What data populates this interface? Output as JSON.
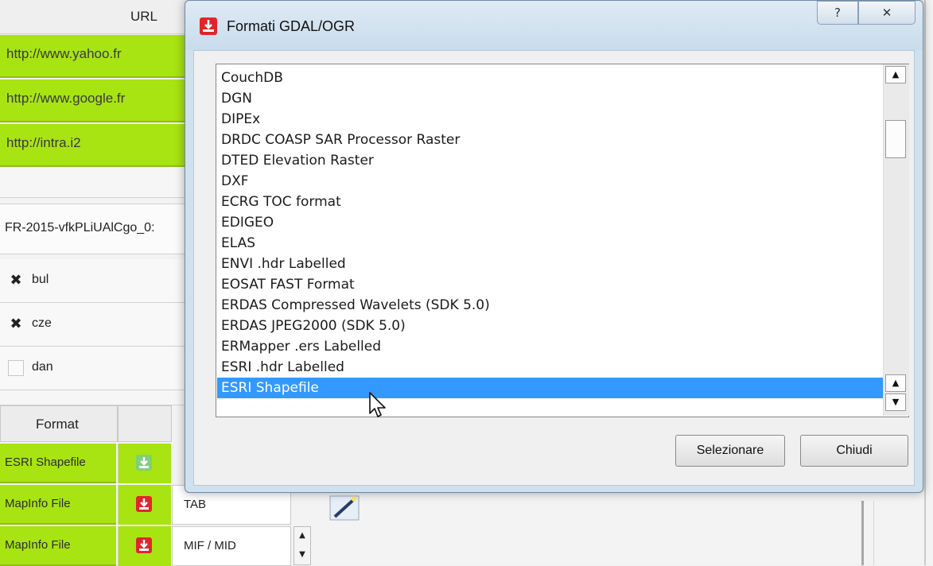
{
  "background": {
    "url_header": "URL",
    "urls": [
      "http://www.yahoo.fr",
      "http://www.google.fr",
      "http://intra.i2"
    ],
    "text_field": "FR-2015-vfkPLiUAlCgo_0:",
    "languages": [
      {
        "label": "bul",
        "checked": true
      },
      {
        "label": "cze",
        "checked": true
      },
      {
        "label": "dan",
        "checked": false
      }
    ],
    "format_header": "Format",
    "formats": [
      {
        "name": "ESRI Shapefile",
        "icon": "download-green-icon",
        "ext": ""
      },
      {
        "name": "MapInfo File",
        "icon": "download-red-icon",
        "ext": "TAB"
      },
      {
        "name": "MapInfo File",
        "icon": "download-red-icon",
        "ext": "MIF / MID"
      }
    ]
  },
  "dialog": {
    "title": "Formati GDAL/OGR",
    "help_button": "?",
    "close_button": "✕",
    "items": [
      "CouchDB",
      "DGN",
      "DIPEx",
      "DRDC COASP SAR Processor Raster",
      "DTED Elevation Raster",
      "DXF",
      "ECRG TOC format",
      "EDIGEO",
      "ELAS",
      "ENVI .hdr Labelled",
      "EOSAT FAST Format",
      "ERDAS Compressed Wavelets (SDK 5.0)",
      "ERDAS JPEG2000 (SDK 5.0)",
      "ERMapper .ers Labelled",
      "ESRI .hdr Labelled",
      "ESRI Shapefile"
    ],
    "selected_item": "ESRI Shapefile",
    "select_button": "Selezionare",
    "close_dialog_button": "Chiudi"
  },
  "colors": {
    "accent_green": "#a8e312",
    "selection_blue": "#3399ff",
    "icon_red": "#e0262b"
  }
}
